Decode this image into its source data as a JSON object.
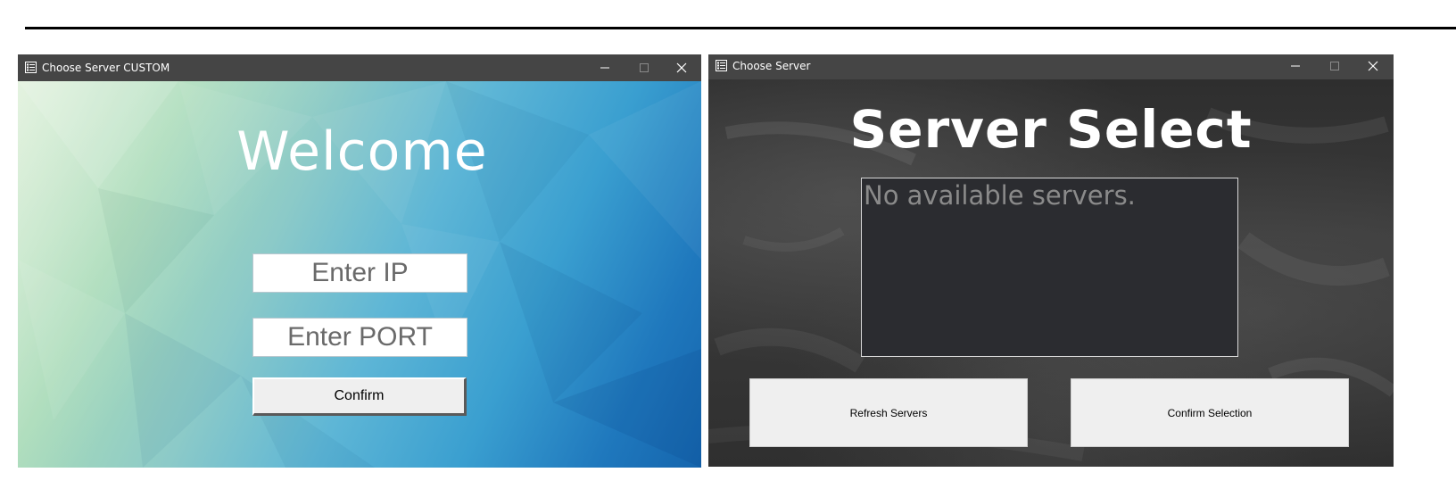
{
  "left_window": {
    "title": "Choose Server CUSTOM",
    "heading": "Welcome",
    "ip_placeholder": "Enter IP",
    "port_placeholder": "Enter PORT",
    "confirm_label": "Confirm",
    "icons": [
      "app-list-icon",
      "minimize-icon",
      "maximize-icon",
      "close-icon"
    ]
  },
  "right_window": {
    "title": "Choose Server",
    "heading": "Server Select",
    "empty_list_text": "No available servers.",
    "refresh_label": "Refresh Servers",
    "confirm_label": "Confirm Selection",
    "icons": [
      "app-list-icon",
      "minimize-icon",
      "maximize-icon",
      "close-icon"
    ]
  },
  "colors": {
    "titlebar": "#454545",
    "button_face": "#efefef",
    "list_background": "#2b2c30",
    "placeholder_text": "#6a6a6a"
  }
}
